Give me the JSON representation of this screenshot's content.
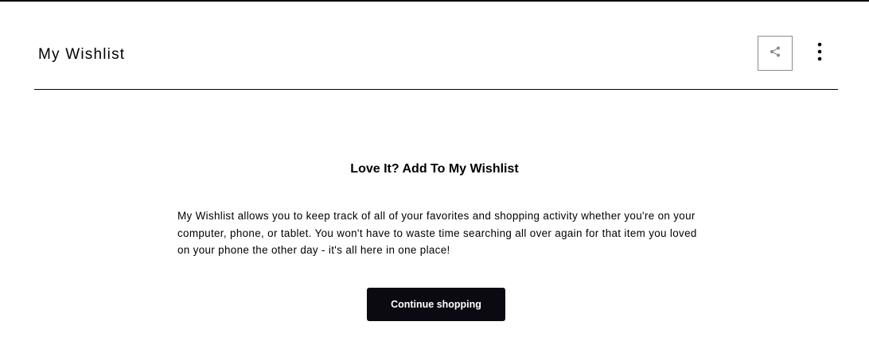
{
  "header": {
    "title": "My Wishlist",
    "share_icon": "share-icon",
    "more_icon": "more-vertical-icon"
  },
  "empty_state": {
    "heading": "Love It? Add To My Wishlist",
    "description": "My Wishlist allows you to keep track of all of your favorites and shopping activity whether you're on your computer, phone, or tablet. You won't have to waste time searching all over again for that item you loved on your phone the other day - it's all here in one place!",
    "button_label": "Continue shopping"
  },
  "colors": {
    "button_bg": "#0b0a12",
    "button_text": "#ffffff",
    "share_border": "#8c8c8c"
  }
}
